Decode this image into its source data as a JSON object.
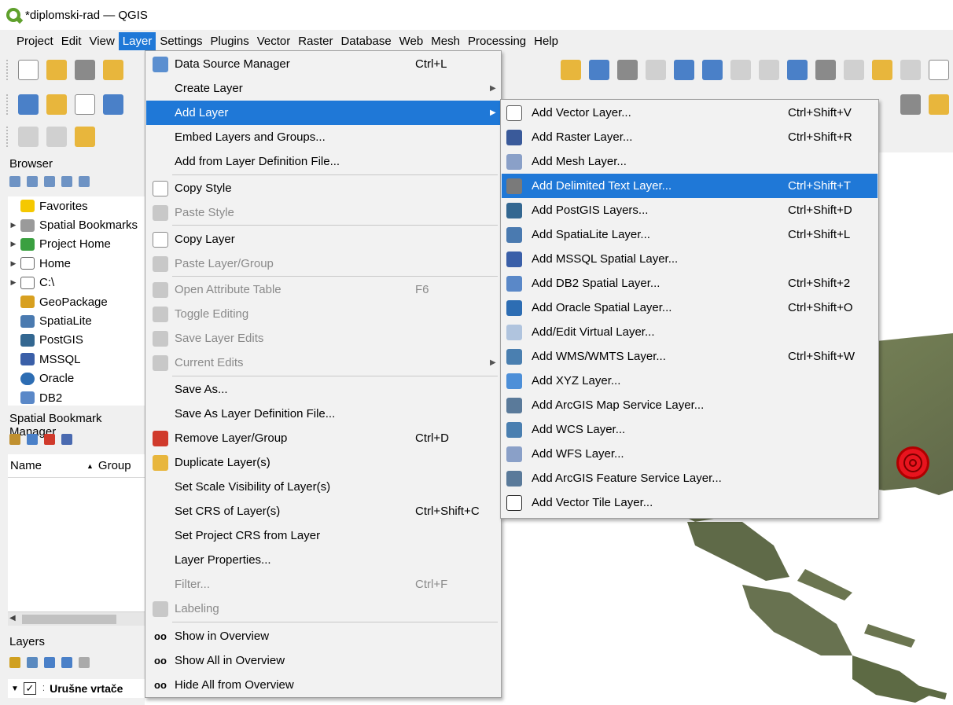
{
  "window": {
    "title": "*diplomski-rad — QGIS"
  },
  "menubar": {
    "items": [
      {
        "label": "Project"
      },
      {
        "label": "Edit"
      },
      {
        "label": "View"
      },
      {
        "label": "Layer"
      },
      {
        "label": "Settings"
      },
      {
        "label": "Plugins"
      },
      {
        "label": "Vector"
      },
      {
        "label": "Raster"
      },
      {
        "label": "Database"
      },
      {
        "label": "Web"
      },
      {
        "label": "Mesh"
      },
      {
        "label": "Processing"
      },
      {
        "label": "Help"
      }
    ]
  },
  "browser": {
    "title": "Browser",
    "items": [
      {
        "label": "Favorites"
      },
      {
        "label": "Spatial Bookmarks"
      },
      {
        "label": "Project Home"
      },
      {
        "label": "Home"
      },
      {
        "label": "C:\\"
      },
      {
        "label": "GeoPackage"
      },
      {
        "label": "SpatiaLite"
      },
      {
        "label": "PostGIS"
      },
      {
        "label": "MSSQL"
      },
      {
        "label": "Oracle"
      },
      {
        "label": "DB2"
      }
    ]
  },
  "bookmarks": {
    "title": "Spatial Bookmark Manager",
    "col_name": "Name",
    "col_group": "Group"
  },
  "layers": {
    "title": "Layers",
    "layer_name": "Urušne vrtače"
  },
  "layer_menu": {
    "items": [
      {
        "label": "Data Source Manager",
        "shortcut": "Ctrl+L"
      },
      {
        "label": "Create Layer"
      },
      {
        "label": "Add Layer"
      },
      {
        "label": "Embed Layers and Groups..."
      },
      {
        "label": "Add from Layer Definition File..."
      },
      {
        "label": "Copy Style"
      },
      {
        "label": "Paste Style"
      },
      {
        "label": "Copy Layer"
      },
      {
        "label": "Paste Layer/Group"
      },
      {
        "label": "Open Attribute Table",
        "shortcut": "F6"
      },
      {
        "label": "Toggle Editing"
      },
      {
        "label": "Save Layer Edits"
      },
      {
        "label": "Current Edits"
      },
      {
        "label": "Save As..."
      },
      {
        "label": "Save As Layer Definition File..."
      },
      {
        "label": "Remove Layer/Group",
        "shortcut": "Ctrl+D"
      },
      {
        "label": "Duplicate Layer(s)"
      },
      {
        "label": "Set Scale Visibility of Layer(s)"
      },
      {
        "label": "Set CRS of Layer(s)",
        "shortcut": "Ctrl+Shift+C"
      },
      {
        "label": "Set Project CRS from Layer"
      },
      {
        "label": "Layer Properties..."
      },
      {
        "label": "Filter...",
        "shortcut": "Ctrl+F"
      },
      {
        "label": "Labeling"
      },
      {
        "label": "Show in Overview"
      },
      {
        "label": "Show All in Overview"
      },
      {
        "label": "Hide All from Overview"
      }
    ]
  },
  "add_layer_submenu": {
    "items": [
      {
        "label": "Add Vector Layer...",
        "shortcut": "Ctrl+Shift+V"
      },
      {
        "label": "Add Raster Layer...",
        "shortcut": "Ctrl+Shift+R"
      },
      {
        "label": "Add Mesh Layer..."
      },
      {
        "label": "Add Delimited Text Layer...",
        "shortcut": "Ctrl+Shift+T"
      },
      {
        "label": "Add PostGIS Layers...",
        "shortcut": "Ctrl+Shift+D"
      },
      {
        "label": "Add SpatiaLite Layer...",
        "shortcut": "Ctrl+Shift+L"
      },
      {
        "label": "Add MSSQL Spatial Layer..."
      },
      {
        "label": "Add DB2 Spatial Layer...",
        "shortcut": "Ctrl+Shift+2"
      },
      {
        "label": "Add Oracle Spatial Layer...",
        "shortcut": "Ctrl+Shift+O"
      },
      {
        "label": "Add/Edit Virtual Layer..."
      },
      {
        "label": "Add WMS/WMTS Layer...",
        "shortcut": "Ctrl+Shift+W"
      },
      {
        "label": "Add XYZ Layer..."
      },
      {
        "label": "Add ArcGIS Map Service Layer..."
      },
      {
        "label": "Add WCS Layer..."
      },
      {
        "label": "Add WFS Layer..."
      },
      {
        "label": "Add ArcGIS Feature Service Layer..."
      },
      {
        "label": "Add Vector Tile Layer..."
      }
    ]
  },
  "colors": {
    "menu_highlight": "#1f78d7",
    "marker": "#e8141e",
    "map_terrain": "#6f7a52"
  }
}
